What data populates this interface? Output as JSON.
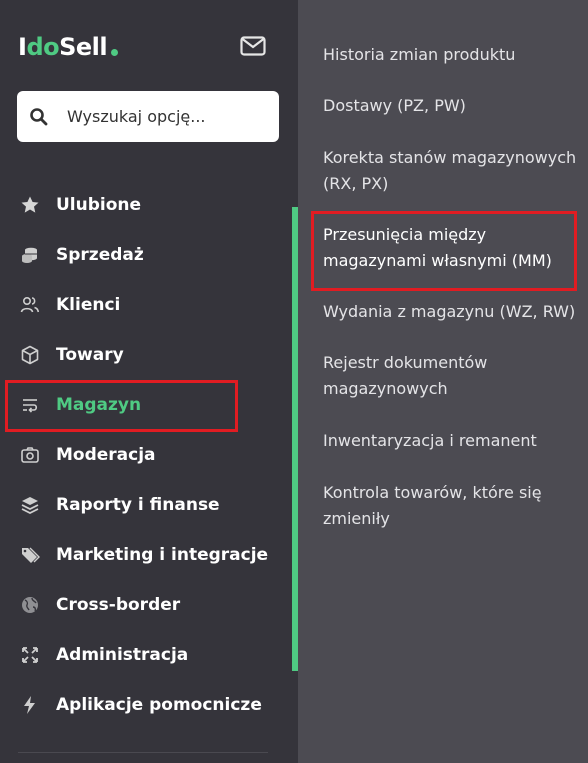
{
  "brand": {
    "part1": "I",
    "part2": "do",
    "part3": "Sell"
  },
  "search": {
    "placeholder": "Wyszukaj opcję..."
  },
  "nav": [
    {
      "label": "Ulubione",
      "icon": "star-icon"
    },
    {
      "label": "Sprzedaż",
      "icon": "coins-icon"
    },
    {
      "label": "Klienci",
      "icon": "users-icon"
    },
    {
      "label": "Towary",
      "icon": "box-icon"
    },
    {
      "label": "Magazyn",
      "icon": "warehouse-icon"
    },
    {
      "label": "Moderacja",
      "icon": "camera-icon"
    },
    {
      "label": "Raporty i finanse",
      "icon": "layers-icon"
    },
    {
      "label": "Marketing i integracje",
      "icon": "tags-icon"
    },
    {
      "label": "Cross-border",
      "icon": "globe-icon"
    },
    {
      "label": "Administracja",
      "icon": "expand-icon"
    },
    {
      "label": "Aplikacje pomocnicze",
      "icon": "bolt-icon"
    }
  ],
  "submenu": [
    "Historia zmian produktu",
    "Dostawy (PZ, PW)",
    "Korekta stanów magazynowych (RX, PX)",
    "Przesunięcia między magazynami własnymi (MM)",
    "Wydania z magazynu (WZ, RW)",
    "Rejestr dokumentów magazynowych",
    "Inwentaryzacja i remanent",
    "Kontrola towarów, które się zmieniły"
  ],
  "colors": {
    "accent": "#4fca83",
    "highlight": "#e11c22",
    "sidebar": "#35343b",
    "panel": "#4c4b52"
  }
}
